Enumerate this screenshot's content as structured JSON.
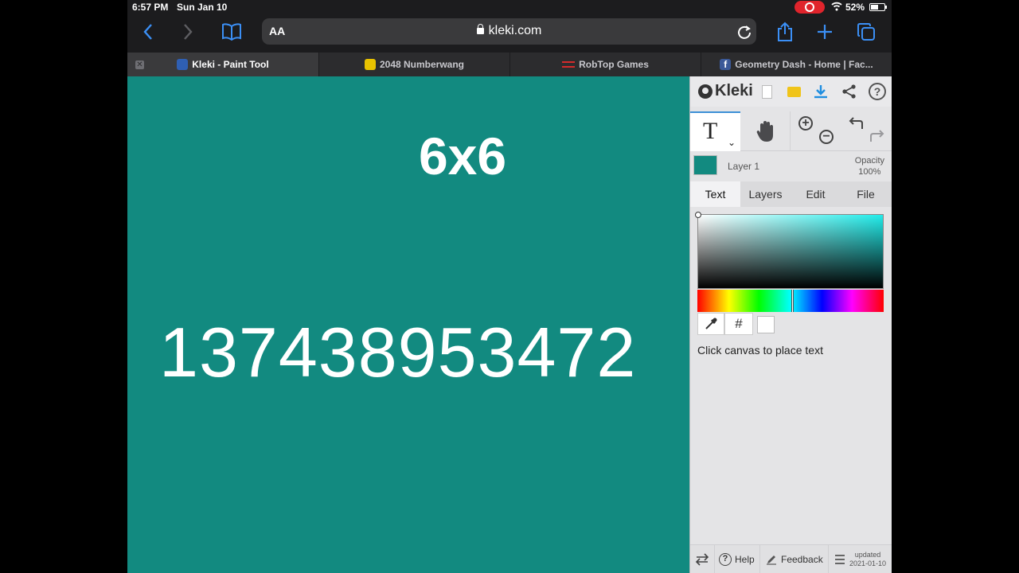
{
  "status_bar": {
    "time": "6:57 PM",
    "date": "Sun Jan 10",
    "battery": "52%"
  },
  "toolbar": {
    "reader_label": "AA",
    "url": "kleki.com"
  },
  "tabs": [
    {
      "label": "Kleki - Paint Tool",
      "favicon_color": "#2f5fb3",
      "active": true
    },
    {
      "label": "2048 Numberwang",
      "favicon_color": "#e8c200",
      "active": false
    },
    {
      "label": "RobTop Games",
      "favicon_color": "#d42b2b",
      "active": false
    },
    {
      "label": "Geometry Dash - Home | Fac...",
      "favicon_color": "#3b5998",
      "active": false
    }
  ],
  "canvas": {
    "background": "#128a80",
    "title_text": "6x6",
    "number_text": "137438953472"
  },
  "kleki": {
    "logo": "Kleki",
    "layer": {
      "name": "Layer 1",
      "opacity_label": "Opacity",
      "opacity_value": "100%"
    },
    "panel_tabs": [
      "Text",
      "Layers",
      "Edit",
      "File"
    ],
    "active_tab": "Text",
    "color": {
      "hue_color": "#22ecea",
      "current": "#ffffff",
      "hex_symbol": "#"
    },
    "hint": "Click canvas to place text",
    "footer": {
      "help": "Help",
      "feedback": "Feedback",
      "updated_label": "updated",
      "updated_date": "2021-01-10"
    }
  }
}
